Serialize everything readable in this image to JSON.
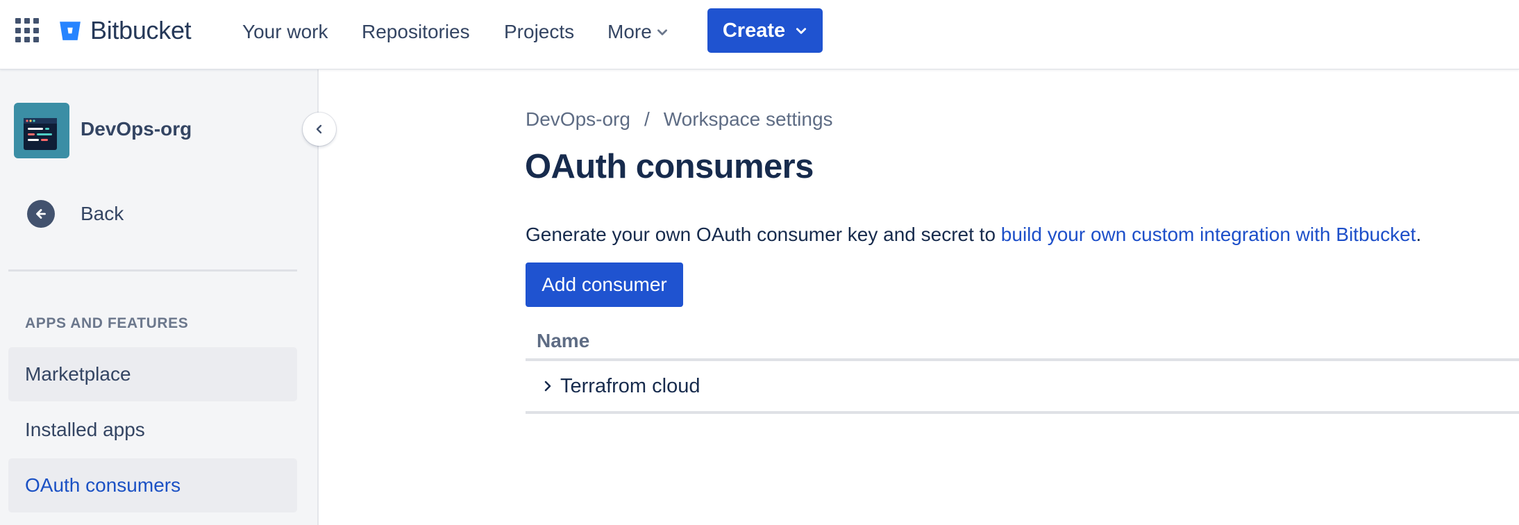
{
  "topnav": {
    "logo_text": "Bitbucket",
    "items": [
      {
        "label": "Your work"
      },
      {
        "label": "Repositories"
      },
      {
        "label": "Projects"
      },
      {
        "label": "More"
      }
    ],
    "create_label": "Create",
    "brand_color": "#1f53d0",
    "logo_color": "#2684ff"
  },
  "sidebar": {
    "workspace_name": "DevOps-org",
    "back_label": "Back",
    "section_heading": "APPS AND FEATURES",
    "items": [
      {
        "label": "Marketplace"
      },
      {
        "label": "Installed apps"
      },
      {
        "label": "OAuth consumers"
      }
    ],
    "active_item": "OAuth consumers"
  },
  "main": {
    "breadcrumb": [
      "DevOps-org",
      "Workspace settings"
    ],
    "breadcrumb_separator": "/",
    "title": "OAuth consumers",
    "description_prefix": "Generate your own OAuth consumer key and secret to ",
    "description_link": "build your own custom integration with Bitbucket",
    "description_suffix": ".",
    "add_button": "Add consumer",
    "table": {
      "header": "Name",
      "rows": [
        {
          "name": "Terrafrom cloud"
        }
      ]
    }
  }
}
